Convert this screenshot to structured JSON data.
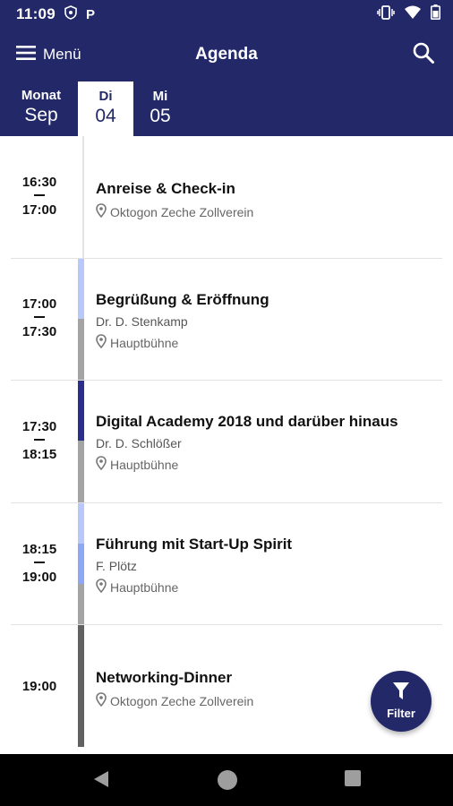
{
  "status": {
    "time": "11:09",
    "icons": [
      "shield-icon",
      "parking-p-icon",
      "vibrate-icon",
      "wifi-icon",
      "battery-icon"
    ],
    "p_glyph": "P"
  },
  "appbar": {
    "menu_label": "Menü",
    "title": "Agenda",
    "search_icon": "search-icon"
  },
  "datebar": {
    "month_label": "Monat",
    "month_value": "Sep",
    "days": [
      {
        "weekday": "Di",
        "day": "04",
        "selected": true
      },
      {
        "weekday": "Mi",
        "day": "05",
        "selected": false
      }
    ]
  },
  "sessions": [
    {
      "start": "16:30",
      "end": "17:00",
      "title": "Anreise & Check-in",
      "speaker": "",
      "location": "Oktogon Zeche Zollverein"
    },
    {
      "start": "17:00",
      "end": "17:30",
      "title": "Begrüßung & Eröffnung",
      "speaker": "Dr. D. Stenkamp",
      "location": "Hauptbühne"
    },
    {
      "start": "17:30",
      "end": "18:15",
      "title": "Digital Academy 2018 und darüber hinaus",
      "speaker": "Dr. D. Schlößer",
      "location": "Hauptbühne"
    },
    {
      "start": "18:15",
      "end": "19:00",
      "title": "Führung mit Start-Up Spirit",
      "speaker": "F. Plötz",
      "location": "Hauptbühne"
    },
    {
      "start": "19:00",
      "end": "",
      "title": "Networking-Dinner",
      "speaker": "",
      "location": "Oktogon Zeche Zollverein"
    }
  ],
  "fab": {
    "label": "Filter",
    "icon": "filter-icon"
  },
  "colors": {
    "primary": "#232869",
    "strip_light": "#b9c8fb",
    "strip_medium": "#8fa8f5",
    "strip_dark": "#2a2f8c",
    "strip_gray": "#a4a4a4",
    "strip_darkgray": "#616161"
  }
}
